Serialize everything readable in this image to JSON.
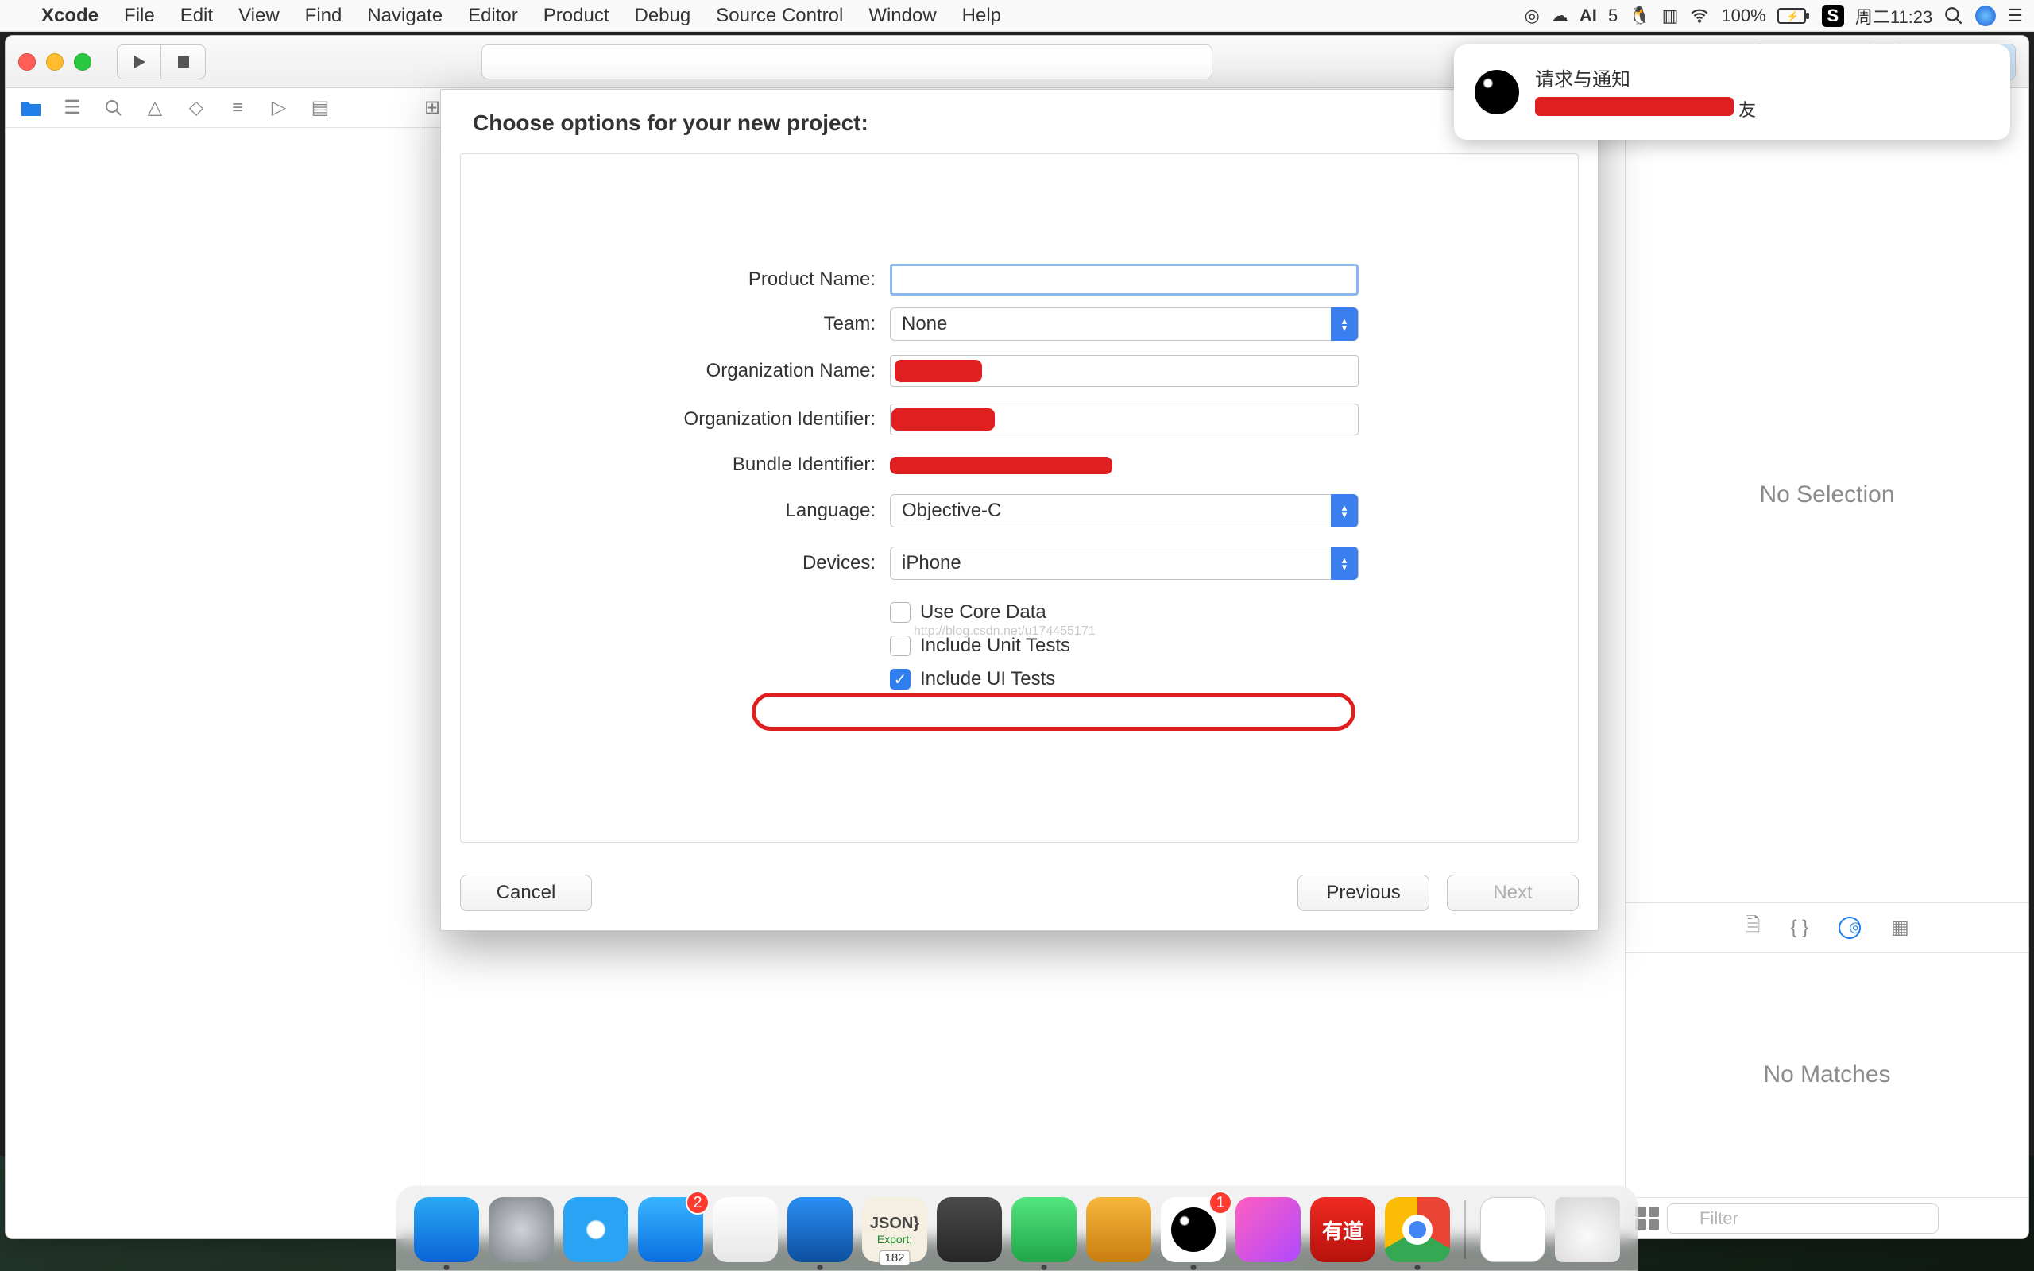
{
  "menubar": {
    "app": "Xcode",
    "items": [
      "File",
      "Edit",
      "View",
      "Find",
      "Navigate",
      "Editor",
      "Product",
      "Debug",
      "Source Control",
      "Window",
      "Help"
    ],
    "battery_pct": "100%",
    "clock": "周二11:23",
    "ai_label": "5"
  },
  "notification": {
    "title": "请求与通知",
    "subtitle_suffix": "友"
  },
  "inspector": {
    "no_selection": "No Selection",
    "no_matches": "No Matches",
    "filter_placeholder": "Filter"
  },
  "sheet": {
    "title": "Choose options for your new project:",
    "labels": {
      "product_name": "Product Name:",
      "team": "Team:",
      "org_name": "Organization Name:",
      "org_id": "Organization Identifier:",
      "bundle_id": "Bundle Identifier:",
      "language": "Language:",
      "devices": "Devices:"
    },
    "values": {
      "product_name": "",
      "team": "None",
      "org_name": "",
      "org_id": "",
      "bundle_id": "",
      "language": "Objective-C",
      "devices": "iPhone"
    },
    "checkboxes": {
      "core_data": "Use Core Data",
      "unit_tests": "Include Unit Tests",
      "ui_tests": "Include UI Tests"
    },
    "watermark": "http://blog.csdn.net/u174455171",
    "buttons": {
      "cancel": "Cancel",
      "previous": "Previous",
      "next": "Next"
    }
  },
  "dock": {
    "apps": [
      {
        "name": "finder",
        "color1": "#2aa9f5",
        "color2": "#0a63d6"
      },
      {
        "name": "launchpad",
        "color1": "#9aa0a6",
        "color2": "#5a5e63"
      },
      {
        "name": "safari",
        "color1": "#2aa3f4",
        "color2": "#0d5fbe"
      },
      {
        "name": "appstore",
        "color1": "#2aa3f4",
        "color2": "#0d5fbe",
        "badge": "2"
      },
      {
        "name": "textedit",
        "color1": "#fafafa",
        "color2": "#d8d8d8"
      },
      {
        "name": "xcode",
        "color1": "#2a8ef4",
        "color2": "#0d4f9e"
      },
      {
        "name": "json",
        "color1": "#f7f3e7",
        "color2": "#e9e0c4",
        "label": "JSON"
      },
      {
        "name": "sublime",
        "color1": "#4a4a4a",
        "color2": "#2a2a2a"
      },
      {
        "name": "wechat",
        "color1": "#41d96b",
        "color2": "#1fa64a"
      },
      {
        "name": "mweb",
        "color1": "#f5a623",
        "color2": "#c97e0f"
      },
      {
        "name": "qq",
        "color1": "#f9f9f9",
        "color2": "#e6e6e6",
        "badge": "1"
      },
      {
        "name": "itunes",
        "color1": "#ff5fc0",
        "color2": "#b048ff"
      },
      {
        "name": "youdao",
        "color1": "#e2231a",
        "color2": "#b5120c",
        "label": "有道"
      },
      {
        "name": "chrome",
        "color1": "#f3f3f3",
        "color2": "#d7d7d7"
      }
    ],
    "small_badges": {
      "json": "182"
    }
  }
}
